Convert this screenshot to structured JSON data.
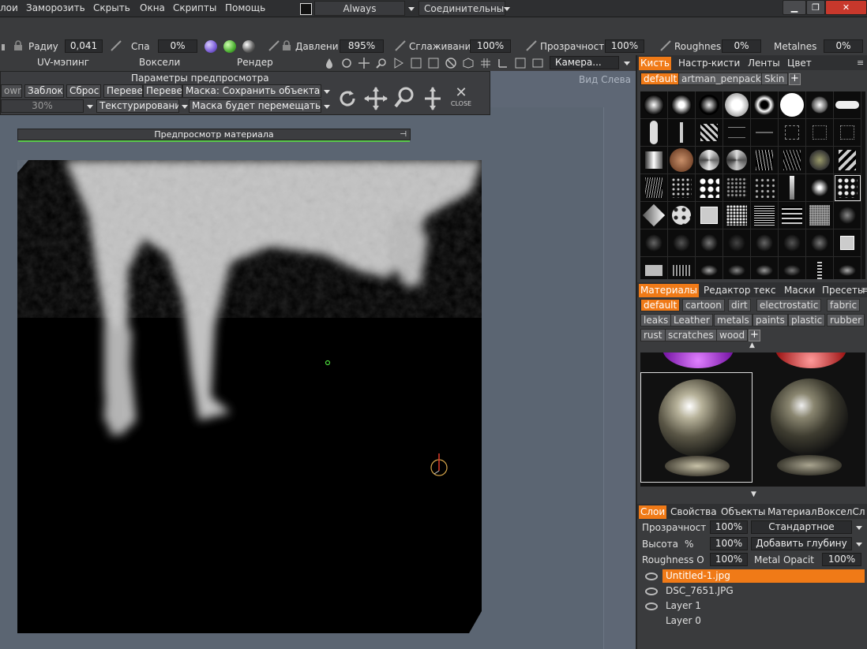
{
  "menubar": {
    "items": [
      "лои",
      "Заморозить",
      "Скрыть",
      "Окна",
      "Скрипты",
      "Помощь"
    ],
    "always_label": "Always",
    "connect_label": "Соединительны"
  },
  "toolbar": {
    "radius_label": "Радиу",
    "radius_value": "0,041",
    "spa_label": "Спа",
    "spa_value": "0%",
    "pressure_label": "Давлени",
    "pressure_value": "895%",
    "smooth_label": "Сглаживани",
    "smooth_value": "100%",
    "opacity_label": "Прозрачност",
    "opacity_value": "100%",
    "roughness_label": "Roughnes",
    "roughness_value": "0%",
    "metalness_label": "Metalnes",
    "metalness_value": "0%",
    "tab_uv": "UV-мэпинг",
    "tab_voxels": "Воксели",
    "tab_render": "Рендер",
    "camera_label": "Камера..."
  },
  "viewport": {
    "view_label": "Вид Слева"
  },
  "ref_panel": {
    "title": "Параметры предпросмотра",
    "btn_own": "own",
    "btn_lock": "Заблоки",
    "btn_reset": "Сброс",
    "btn_flip1": "Перевер",
    "btn_flip2": "Перевер",
    "mask_save": "Маска: Сохранить объекта",
    "opacity_value": "30%",
    "texturing": "Текстурировани",
    "mask_move": "Маска будет перемещать",
    "close_label": "CLOSE"
  },
  "mat_preview": {
    "title": "Предпросмотр материала"
  },
  "brush_panel": {
    "tabs": [
      "Кисть",
      "Настр-кисти",
      "Ленты",
      "Цвет"
    ],
    "chips": [
      "default",
      "artman_penpack",
      "Skin"
    ]
  },
  "materials_panel": {
    "tabs": [
      "Материалы",
      "Редактор текс",
      "Маски",
      "Пресеты"
    ],
    "chips_row1": [
      "default",
      "cartoon",
      "dirt",
      "electrostatic",
      "fabric"
    ],
    "chips_row2": [
      "leaks",
      "Leather",
      "metals",
      "paints",
      "plastic",
      "rubber"
    ],
    "chips_row3": [
      "rust",
      "scratches",
      "wood"
    ]
  },
  "layers_panel": {
    "tabs": [
      "Слои",
      "Свойства",
      "Объекты",
      "Материал",
      "ВокселСл"
    ],
    "opacity_label": "Прозрачност",
    "opacity_value": "100%",
    "blend_mode": "Стандартное",
    "height_label": "Высота",
    "height_unit": "%",
    "height_value": "100%",
    "depth_mode": "Добавить глубину",
    "roughness_label": "Roughness O",
    "roughness_value": "100%",
    "metal_label": "Metal Opacit",
    "metal_value": "100%",
    "layers": [
      "Untitled-1.jpg",
      "DSC_7651.JPG",
      "Layer 1",
      "Layer 0"
    ]
  },
  "colors": {
    "accent": "#f07a17",
    "green": "#59c94a"
  }
}
